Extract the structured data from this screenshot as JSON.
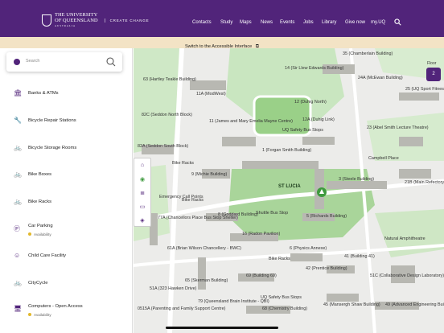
{
  "header": {
    "logo_line1": "THE UNIVERSITY",
    "logo_line2": "OF QUEENSLAND",
    "logo_line3": "AUSTRALIA",
    "tagline": "CREATE CHANGE",
    "nav": [
      "Contacts",
      "Study",
      "Maps",
      "News",
      "Events",
      "Jobs",
      "Library",
      "Give now",
      "my.UQ"
    ]
  },
  "banner": {
    "text": "Switch to the Accessible Interface"
  },
  "search": {
    "placeholder": "Search"
  },
  "categories": [
    {
      "label": "Banks & ATMs",
      "sub": "",
      "icon": "bank-icon"
    },
    {
      "label": "Bicycle Repair Stations",
      "sub": "",
      "icon": "wrench-icon"
    },
    {
      "label": "Bicycle Storage Rooms",
      "sub": "",
      "icon": "bicycle-room-icon"
    },
    {
      "label": "Bike Boxes",
      "sub": "",
      "icon": "bike-box-icon"
    },
    {
      "label": "Bike Racks",
      "sub": "",
      "icon": "bike-rack-icon"
    },
    {
      "label": "Car Parking",
      "sub": "Availability",
      "icon": "parking-icon"
    },
    {
      "label": "Child Care Facility",
      "sub": "",
      "icon": "child-care-icon"
    },
    {
      "label": "CityCycle",
      "sub": "",
      "icon": "citycycle-icon"
    },
    {
      "label": "Computers - Open Access",
      "sub": "Availability",
      "icon": "computer-icon"
    }
  ],
  "map": {
    "floor_label": "Floor",
    "floor_value": "2",
    "labels": [
      "35 (Chamberlain Building)",
      "14 (Sir Llew Edwards Building)",
      "63 (Hartley Teakle Building)",
      "24A (McEwan Building)",
      "25 (UQ Sport Fitness Centre)",
      "11A (ModWest)",
      "12 (Duhig North)",
      "82C (Seddon North Block)",
      "11 (James and Mary Emelia Mayne Centre)",
      "12A (Duhig Link)",
      "UQ Safety Bus Stops",
      "23 (Abel Smith Lecture Theatre)",
      "82A (Seddon South Block)",
      "1 (Forgan Smith Building)",
      "Campbell Place",
      "Bike Racks",
      "9 (Michie Building)",
      "ST LUCIA",
      "3 (Steele Building)",
      "21B (Main Refectory)",
      "Emergency Call Points",
      "Bike Racks",
      "Shuttle Bus Stop",
      "77A (Chancellors Place Bus Stop Shelter)",
      "8 (Goddard Building)",
      "5 (Richards Building)",
      "16 (Radon Pavilion)",
      "6 (Physics Annexe)",
      "61A (Brian Wilson Chancellery - BWC)",
      "Bike Racks",
      "42 (Prentice Building)",
      "41 (Building 41)",
      "65 (Skerman Building)",
      "69 (Building 69)",
      "51C (Collaborative Design Laboratory)",
      "51A (323 Hawken Drive)",
      "79 (Queensland Brain Institute - QBI)",
      "68 (Chemistry Building)",
      "45 (Mansergh Shaw Building)",
      "49 (Advanced Engineering Building)",
      "0515A (Parenting and Family Support Centre)",
      "UQ Safety Bus Stops",
      "Natural Amphitheatre"
    ]
  }
}
